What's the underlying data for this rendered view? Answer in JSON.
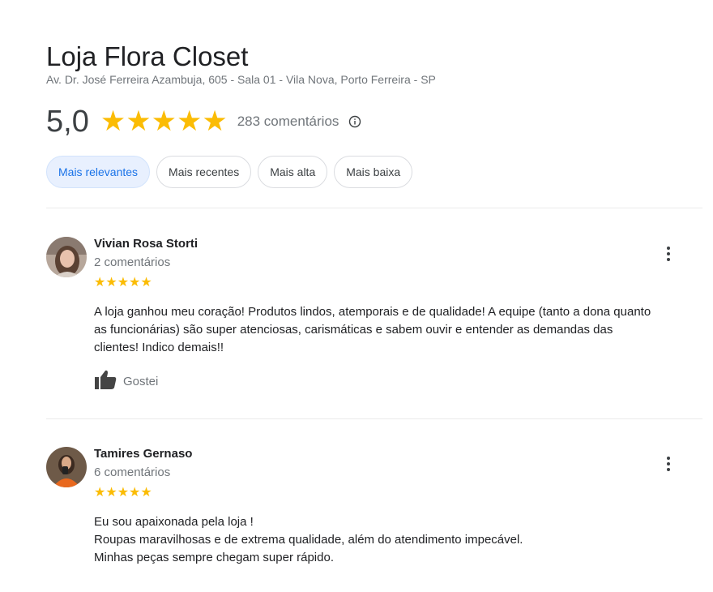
{
  "store": {
    "name": "Loja Flora Closet",
    "address": "Av. Dr. José Ferreira Azambuja, 605 - Sala 01 - Vila Nova, Porto Ferreira - SP",
    "rating": "5,0",
    "stars": "★★★★★",
    "review_count": "283 comentários"
  },
  "filters": [
    {
      "label": "Mais relevantes",
      "active": true
    },
    {
      "label": "Mais recentes",
      "active": false
    },
    {
      "label": "Mais alta",
      "active": false
    },
    {
      "label": "Mais baixa",
      "active": false
    }
  ],
  "reviews": [
    {
      "author": "Vivian Rosa Storti",
      "count": "2 comentários",
      "stars": "★★★★★",
      "text_lines": [
        "A loja ganhou meu coração! Produtos lindos, atemporais e de qualidade! A equipe (tanto a dona quanto",
        "as funcionárias) são super atenciosas, carismáticas e sabem ouvir e entender as demandas das",
        "clientes! Indico demais!!"
      ],
      "like_label": "Gostei"
    },
    {
      "author": "Tamires Gernaso",
      "count": "6 comentários",
      "stars": "★★★★★",
      "text_lines": [
        "Eu sou apaixonada pela loja !",
        "Roupas maravilhosas e de extrema qualidade, além do atendimento impecável.",
        "Minhas peças sempre chegam super rápido."
      ]
    }
  ],
  "icons": {
    "info": "info-icon",
    "more": "more-vert-icon",
    "like": "thumb-up-icon"
  },
  "colors": {
    "star": "#fbbc04",
    "active_chip_bg": "#e8f0fe",
    "active_chip_text": "#1a73e8"
  }
}
